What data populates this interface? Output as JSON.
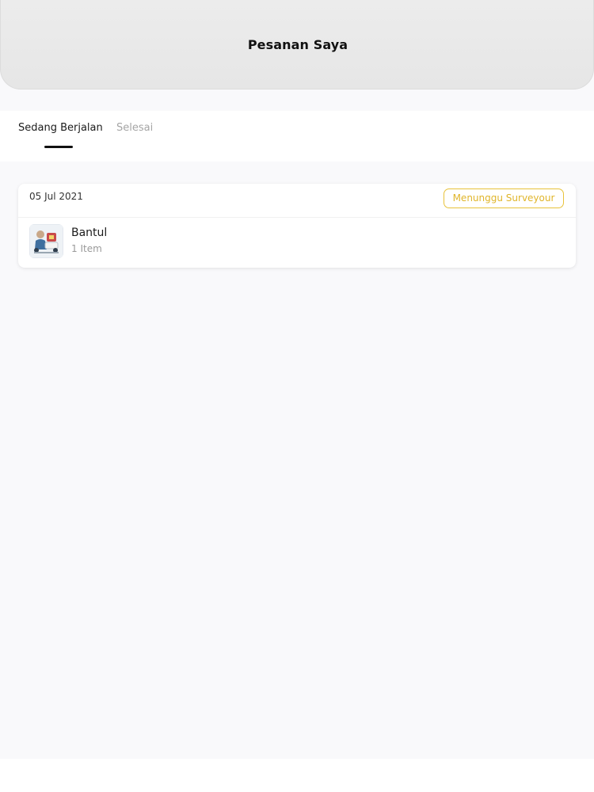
{
  "header": {
    "title": "Pesanan Saya"
  },
  "tabs": [
    {
      "label": "Sedang Berjalan",
      "active": true
    },
    {
      "label": "Selesai",
      "active": false
    }
  ],
  "orders": [
    {
      "date": "05 Jul 2021",
      "status": "Menunggu Surveyour",
      "name": "Bantul",
      "count": "1 Item"
    }
  ],
  "colors": {
    "status_accent": "#e8c23a",
    "tab_active": "#111111",
    "tab_inactive": "#a5a5a5",
    "background": "#f9f9fb"
  }
}
